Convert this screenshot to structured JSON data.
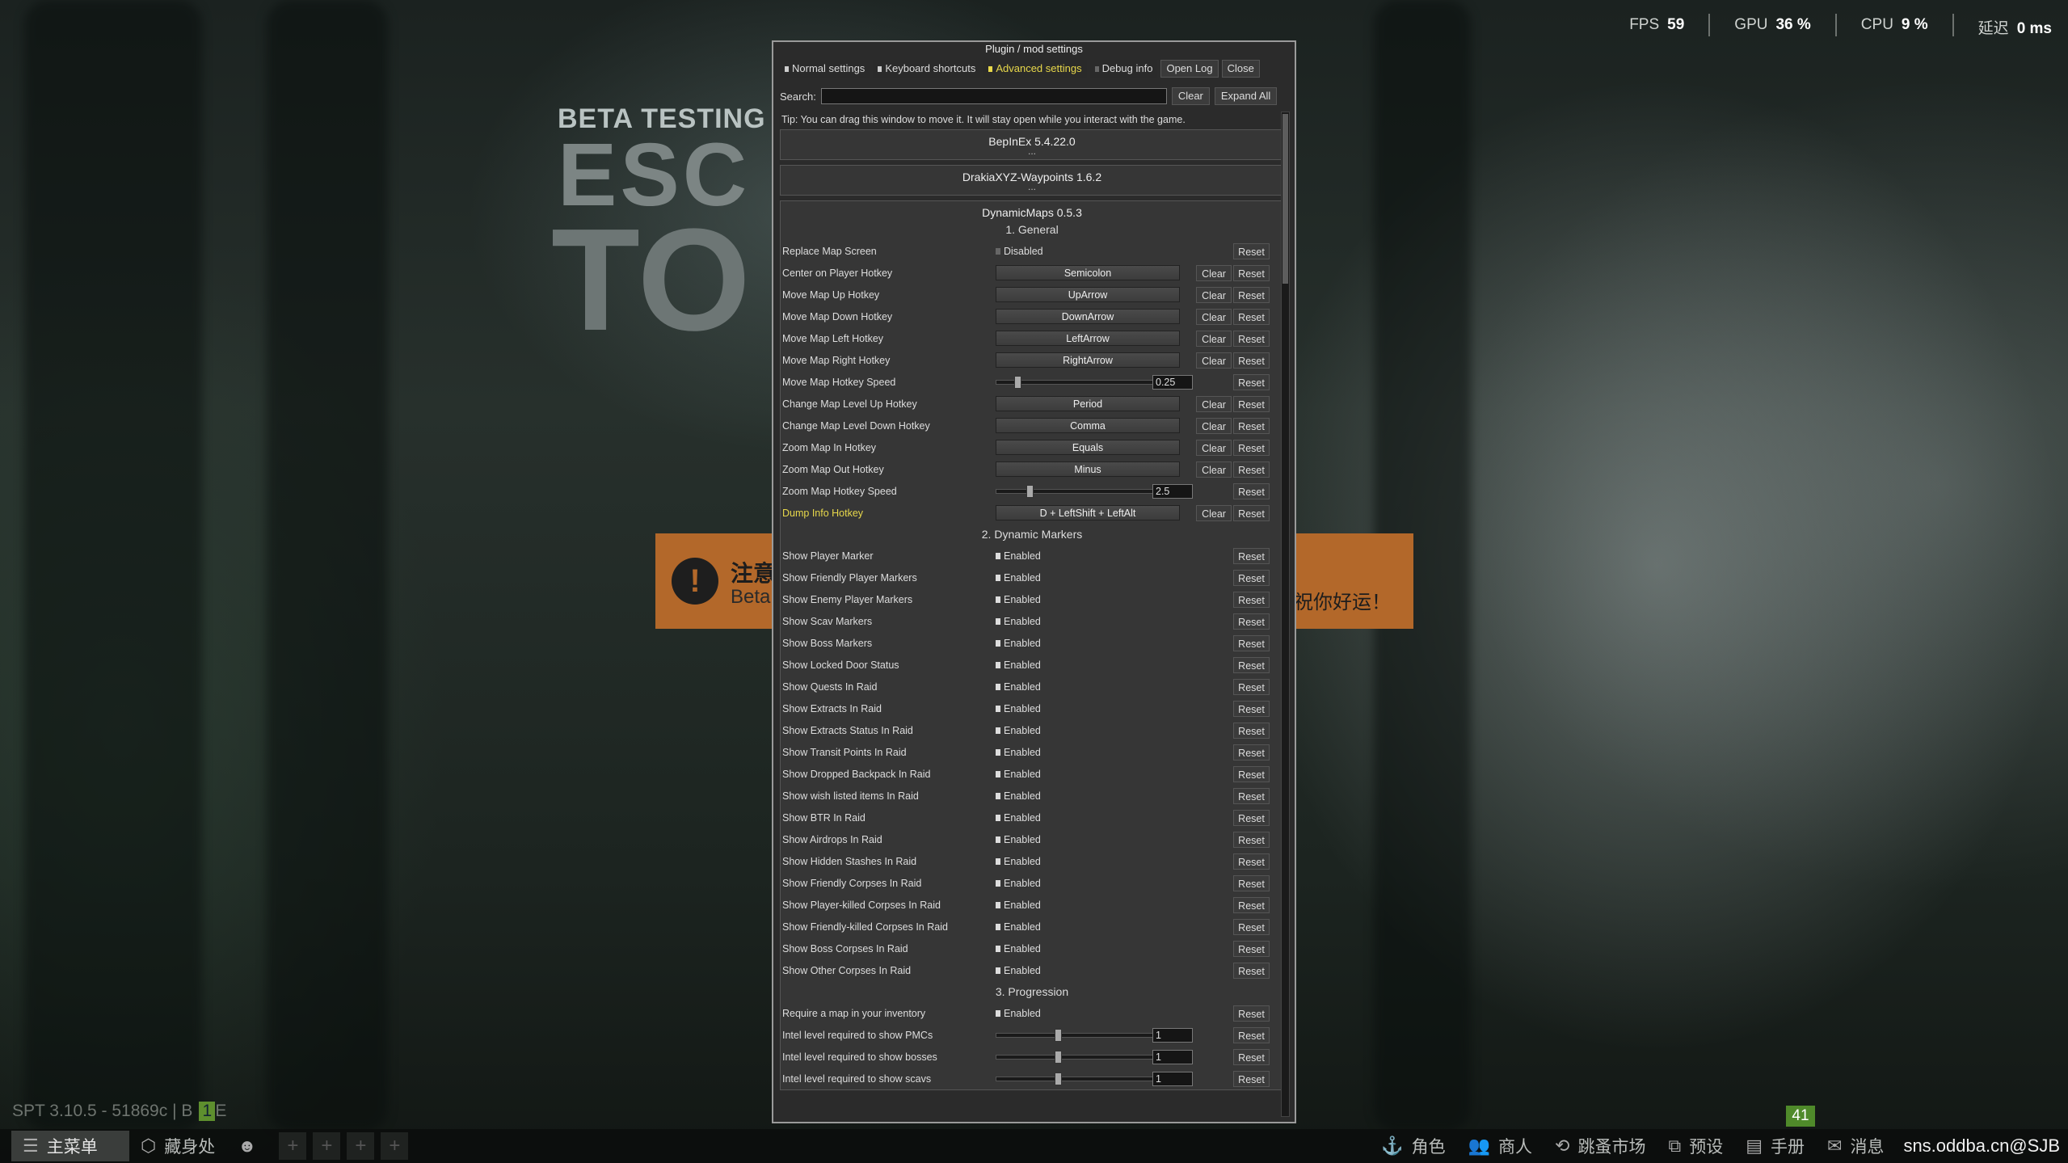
{
  "hud": {
    "fps_label": "FPS",
    "fps_value": "59",
    "gpu_label": "GPU",
    "gpu_value": "36 %",
    "cpu_label": "CPU",
    "cpu_value": "9 %",
    "latency_label": "延迟",
    "latency_value": "0 ms"
  },
  "background": {
    "beta": "BETA TESTING",
    "logo_line1": "ESC",
    "logo_line2": "TO",
    "banner_title": "注意",
    "banner_sub": "Beta",
    "banner_right": "祝你好运！",
    "spt_version": "SPT 3.10.5 - 51869c | B",
    "spt_box": "1",
    "spt_tail": "E",
    "counter": "41"
  },
  "taskbar": {
    "main_menu": "主菜单",
    "hideout": "藏身处",
    "character": "角色",
    "traders": "商人",
    "flea_market": "跳蚤市场",
    "presets": "预设",
    "handbook": "手册",
    "messages": "消息",
    "watermark": "sns.oddba.cn@SJB"
  },
  "window": {
    "title": "Plugin / mod settings",
    "tabs": {
      "normal": "Normal settings",
      "keyboard": "Keyboard shortcuts",
      "advanced": "Advanced settings",
      "debug": "Debug info",
      "open_log": "Open Log",
      "close": "Close"
    },
    "search_label": "Search:",
    "search_value": "",
    "clear_label": "Clear",
    "expand_all": "Expand All",
    "tip": "Tip: You can drag this window to move it. It will stay open while you interact with the game.",
    "mods": [
      {
        "name": "BepInEx 5.4.22.0",
        "dots": "..."
      },
      {
        "name": "DrakiaXYZ-Waypoints 1.6.2",
        "dots": "..."
      }
    ],
    "dynamic_maps_title": "DynamicMaps 0.5.3",
    "reset": "Reset",
    "clear": "Clear",
    "enabled": "Enabled",
    "disabled": "Disabled",
    "sections": {
      "general": "1. General",
      "markers": "2. Dynamic Markers",
      "progression": "3. Progression"
    },
    "general": {
      "replace_map_screen": "Replace Map Screen",
      "center_player": "Center on Player Hotkey",
      "center_player_key": "Semicolon",
      "move_up": "Move Map Up Hotkey",
      "move_up_key": "UpArrow",
      "move_down": "Move Map Down Hotkey",
      "move_down_key": "DownArrow",
      "move_left": "Move Map Left Hotkey",
      "move_left_key": "LeftArrow",
      "move_right": "Move Map Right Hotkey",
      "move_right_key": "RightArrow",
      "move_speed": "Move Map Hotkey Speed",
      "move_speed_value": "0.25",
      "level_up": "Change Map Level Up Hotkey",
      "level_up_key": "Period",
      "level_down": "Change Map Level Down Hotkey",
      "level_down_key": "Comma",
      "zoom_in": "Zoom Map In Hotkey",
      "zoom_in_key": "Equals",
      "zoom_out": "Zoom Map Out Hotkey",
      "zoom_out_key": "Minus",
      "zoom_speed": "Zoom Map Hotkey Speed",
      "zoom_speed_value": "2.5",
      "dump_info": "Dump Info Hotkey",
      "dump_info_key": "D + LeftShift + LeftAlt"
    },
    "slider_levels": {
      "move_speed": 0.1,
      "zoom_speed": 0.17,
      "intel_pmcs": 0.33,
      "intel_bosses": 0.33,
      "intel_scavs": 0.33
    },
    "markers": [
      "Show Player Marker",
      "Show Friendly Player Markers",
      "Show Enemy Player Markers",
      "Show Scav Markers",
      "Show Boss Markers",
      "Show Locked Door Status",
      "Show Quests In Raid",
      "Show Extracts In Raid",
      "Show Extracts Status In Raid",
      "Show Transit Points In Raid",
      "Show Dropped Backpack In Raid",
      "Show wish listed items In Raid",
      "Show BTR In Raid",
      "Show Airdrops In Raid",
      "Show Hidden Stashes In Raid",
      "Show Friendly Corpses In Raid",
      "Show Player-killed Corpses In Raid",
      "Show Friendly-killed Corpses In Raid",
      "Show Boss Corpses In Raid",
      "Show Other Corpses In Raid"
    ],
    "progression": {
      "require_map": "Require a map in your inventory",
      "intel_pmcs": "Intel level required to show PMCs",
      "intel_pmcs_value": "1",
      "intel_bosses": "Intel level required to show bosses",
      "intel_bosses_value": "1",
      "intel_scavs": "Intel level required to show scavs",
      "intel_scavs_value": "1"
    }
  }
}
